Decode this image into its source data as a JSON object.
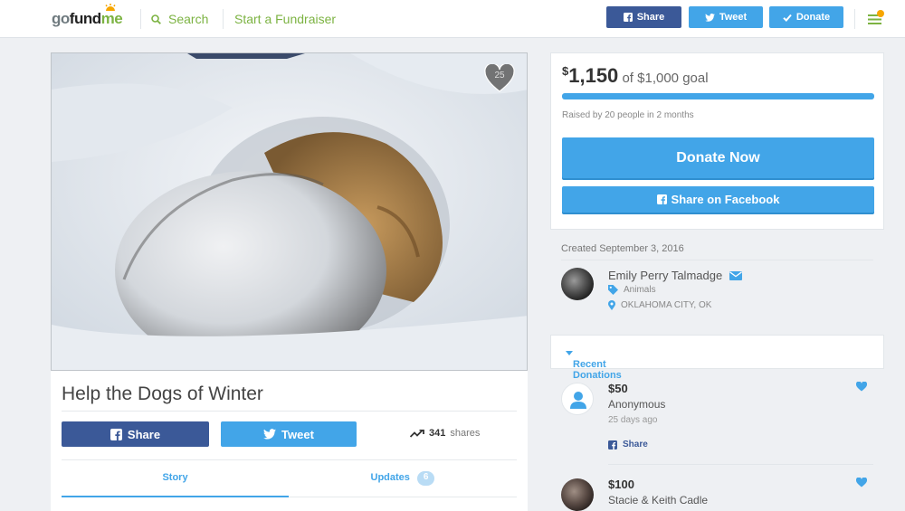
{
  "header": {
    "logo": {
      "go": "go",
      "fund": "fund",
      "me": "me"
    },
    "search_label": "Search",
    "start_label": "Start a Fundraiser",
    "share_label": "Share",
    "tweet_label": "Tweet",
    "donate_label": "Donate",
    "menu_badge": "1"
  },
  "campaign": {
    "favorite_count": "25",
    "title": "Help the Dogs of Winter",
    "share_label": "Share",
    "tweet_label": "Tweet",
    "shares_count": "341",
    "shares_label": "shares",
    "tabs": [
      {
        "label": "Story"
      },
      {
        "label": "Updates",
        "badge": "6"
      }
    ]
  },
  "goal": {
    "currency": "$",
    "raised": "1,150",
    "goal_text": "of $1,000 goal",
    "progress_fraction": 1.0,
    "raised_by": "Raised by 20 people in 2 months",
    "donate_now": "Donate Now",
    "share_facebook": "Share on Facebook"
  },
  "creator": {
    "created": "Created September 3, 2016",
    "name": "Emily Perry Talmadge",
    "category": "Animals",
    "location": "OKLAHOMA CITY, OK"
  },
  "donations": {
    "heading": "Recent Donations",
    "items": [
      {
        "amount": "$50",
        "name": "Anonymous",
        "time": "25 days ago",
        "share": "Share"
      },
      {
        "amount": "$100",
        "name": "Stacie & Keith Cadle"
      }
    ]
  },
  "colors": {
    "brand_green": "#7cb342",
    "facebook_blue": "#3b5998",
    "accent_blue": "#42a5e8"
  },
  "icons": [
    "search-icon",
    "facebook-icon",
    "twitter-icon",
    "check-icon",
    "menu-icon",
    "heart-icon",
    "trend-icon",
    "mail-icon",
    "tag-icon",
    "location-pin-icon",
    "caret-down-icon",
    "user-icon"
  ]
}
